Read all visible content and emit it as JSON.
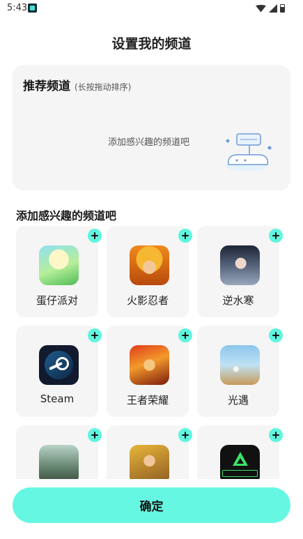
{
  "status_bar": {
    "time": "5:43"
  },
  "header": {
    "title": "设置我的频道"
  },
  "recommend": {
    "title": "推荐频道",
    "hint": "(长按拖动排序)",
    "empty_text": "添加感兴趣的频道吧"
  },
  "add_section": {
    "title": "添加感兴趣的频道吧",
    "channels": [
      {
        "label": "蛋仔派对",
        "icon": "eggy-party-icon"
      },
      {
        "label": "火影忍者",
        "icon": "naruto-icon"
      },
      {
        "label": "逆水寒",
        "icon": "nishuihan-icon"
      },
      {
        "label": "Steam",
        "icon": "steam-icon"
      },
      {
        "label": "王者荣耀",
        "icon": "honor-of-kings-icon"
      },
      {
        "label": "光遇",
        "icon": "sky-icon"
      },
      {
        "label": "",
        "icon": "game-icon"
      },
      {
        "label": "",
        "icon": "pubg-icon"
      },
      {
        "label": "",
        "icon": "delta-force-icon"
      }
    ]
  },
  "footer": {
    "confirm_label": "确定"
  },
  "colors": {
    "accent": "#66f7e3",
    "add_badge": "#5ff5df",
    "panel_bg": "#f5f5f5"
  }
}
